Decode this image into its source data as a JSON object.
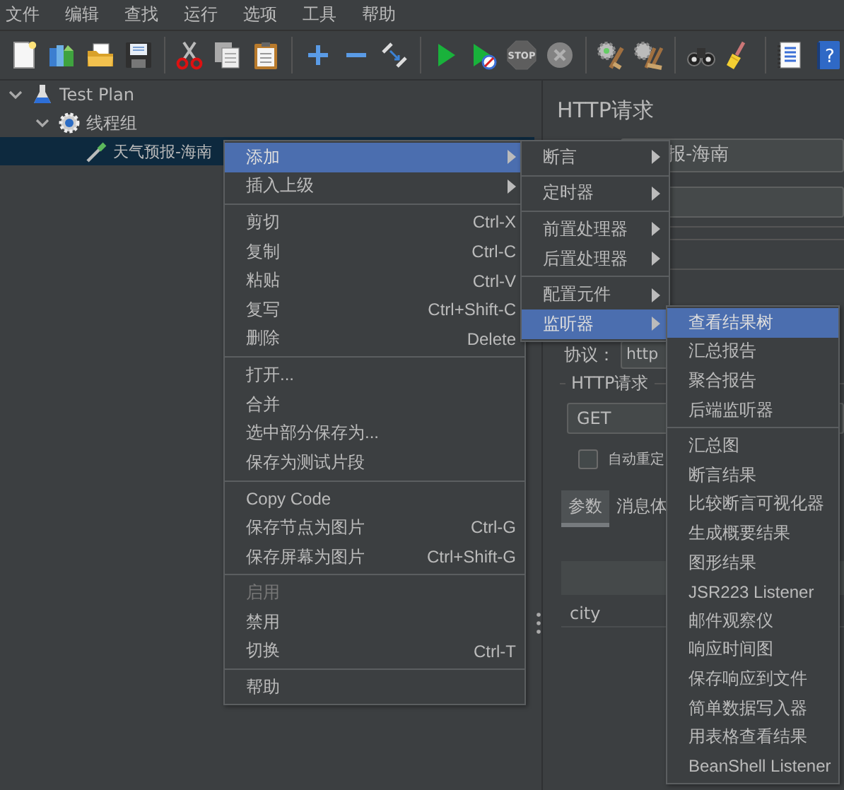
{
  "menu_bar": [
    {
      "label": "文件"
    },
    {
      "label": "编辑"
    },
    {
      "label": "查找"
    },
    {
      "label": "运行"
    },
    {
      "label": "选项"
    },
    {
      "label": "工具"
    },
    {
      "label": "帮助"
    }
  ],
  "toolbar": [
    [
      {
        "kind": "new",
        "disabled": false
      },
      {
        "kind": "templates",
        "disabled": false
      },
      {
        "kind": "open",
        "disabled": false
      },
      {
        "kind": "save",
        "disabled": false
      }
    ],
    [
      {
        "kind": "cut",
        "disabled": false
      },
      {
        "kind": "copy",
        "disabled": false
      },
      {
        "kind": "paste",
        "disabled": false
      }
    ],
    [
      {
        "kind": "expand",
        "disabled": false
      },
      {
        "kind": "collapse",
        "disabled": false
      },
      {
        "kind": "toggle",
        "disabled": false
      }
    ],
    [
      {
        "kind": "start",
        "disabled": false
      },
      {
        "kind": "start_no_pause",
        "disabled": false
      },
      {
        "kind": "stop",
        "disabled": true,
        "label": "STOP"
      },
      {
        "kind": "shutdown",
        "disabled": true
      }
    ],
    [
      {
        "kind": "clear",
        "disabled": false
      },
      {
        "kind": "clear_all",
        "disabled": false
      }
    ],
    [
      {
        "kind": "search",
        "disabled": false
      },
      {
        "kind": "reset_search",
        "disabled": false
      }
    ],
    [
      {
        "kind": "functions",
        "disabled": false
      },
      {
        "kind": "help",
        "disabled": false,
        "label": "?"
      }
    ]
  ],
  "tree": [
    {
      "label": "Test Plan",
      "kind": "plan",
      "expanded": true,
      "selected": false,
      "children": [
        {
          "label": "线程组",
          "kind": "thread_group",
          "expanded": true,
          "selected": false,
          "children": [
            {
              "label": "天气预报-海南",
              "kind": "sampler",
              "selected": true
            }
          ]
        }
      ]
    }
  ],
  "http_panel": {
    "title": "HTTP请求",
    "name_value": "报-海南",
    "protocol_label": "协议：",
    "protocol_value": "http",
    "group_title": "HTTP请求",
    "method": "GET",
    "auto_redirect": {
      "label": "自动重定",
      "checked": false
    },
    "tabs": [
      {
        "label": "参数",
        "selected": true
      },
      {
        "label": "消息体",
        "selected": false
      }
    ],
    "table_rows": [
      [
        "city"
      ]
    ]
  },
  "menus": [
    {
      "groups": [
        [
          {
            "label": "添加",
            "selected": true,
            "disabled": false,
            "submenu": true
          },
          {
            "label": "插入上级",
            "selected": false,
            "disabled": false,
            "submenu": true
          }
        ],
        [
          {
            "label": "剪切",
            "shortcut": "Ctrl-X",
            "selected": false,
            "disabled": false,
            "submenu": false
          },
          {
            "label": "复制",
            "shortcut": "Ctrl-C",
            "selected": false,
            "disabled": false,
            "submenu": false
          },
          {
            "label": "粘贴",
            "shortcut": "Ctrl-V",
            "selected": false,
            "disabled": false,
            "submenu": false
          },
          {
            "label": "复写",
            "shortcut": "Ctrl+Shift-C",
            "selected": false,
            "disabled": false,
            "submenu": false
          },
          {
            "label": "删除",
            "shortcut": "Delete",
            "selected": false,
            "disabled": false,
            "submenu": false
          }
        ],
        [
          {
            "label": "打开...",
            "selected": false,
            "disabled": false,
            "submenu": false
          },
          {
            "label": "合并",
            "selected": false,
            "disabled": false,
            "submenu": false
          },
          {
            "label": "选中部分保存为...",
            "selected": false,
            "disabled": false,
            "submenu": false
          },
          {
            "label": "保存为测试片段",
            "selected": false,
            "disabled": false,
            "submenu": false
          }
        ],
        [
          {
            "label": "Copy Code",
            "selected": false,
            "disabled": false,
            "submenu": false
          },
          {
            "label": "保存节点为图片",
            "shortcut": "Ctrl-G",
            "selected": false,
            "disabled": false,
            "submenu": false
          },
          {
            "label": "保存屏幕为图片",
            "shortcut": "Ctrl+Shift-G",
            "selected": false,
            "disabled": false,
            "submenu": false
          }
        ],
        [
          {
            "label": "启用",
            "selected": false,
            "disabled": true,
            "submenu": false
          },
          {
            "label": "禁用",
            "selected": false,
            "disabled": false,
            "submenu": false
          },
          {
            "label": "切换",
            "shortcut": "Ctrl-T",
            "selected": false,
            "disabled": false,
            "submenu": false
          }
        ],
        [
          {
            "label": "帮助",
            "selected": false,
            "disabled": false,
            "submenu": false
          }
        ]
      ]
    },
    {
      "groups": [
        [
          {
            "label": "断言",
            "selected": false,
            "submenu": true
          }
        ],
        [
          {
            "label": "定时器",
            "selected": false,
            "submenu": true
          }
        ],
        [
          {
            "label": "前置处理器",
            "selected": false,
            "submenu": true
          },
          {
            "label": "后置处理器",
            "selected": false,
            "submenu": true
          }
        ],
        [
          {
            "label": "配置元件",
            "selected": false,
            "submenu": true
          },
          {
            "label": "监听器",
            "selected": true,
            "submenu": true
          }
        ]
      ]
    },
    {
      "groups": [
        [
          {
            "label": "查看结果树",
            "selected": true
          },
          {
            "label": "汇总报告",
            "selected": false
          },
          {
            "label": "聚合报告",
            "selected": false
          },
          {
            "label": "后端监听器",
            "selected": false
          }
        ],
        [
          {
            "label": "汇总图",
            "selected": false
          },
          {
            "label": "断言结果",
            "selected": false
          },
          {
            "label": "比较断言可视化器",
            "selected": false
          },
          {
            "label": "生成概要结果",
            "selected": false
          },
          {
            "label": "图形结果",
            "selected": false
          },
          {
            "label": "JSR223 Listener",
            "selected": false
          },
          {
            "label": "邮件观察仪",
            "selected": false
          },
          {
            "label": "响应时间图",
            "selected": false
          },
          {
            "label": "保存响应到文件",
            "selected": false
          },
          {
            "label": "简单数据写入器",
            "selected": false
          },
          {
            "label": "用表格查看结果",
            "selected": false
          },
          {
            "label": "BeanShell Listener",
            "selected": false
          }
        ]
      ]
    }
  ]
}
